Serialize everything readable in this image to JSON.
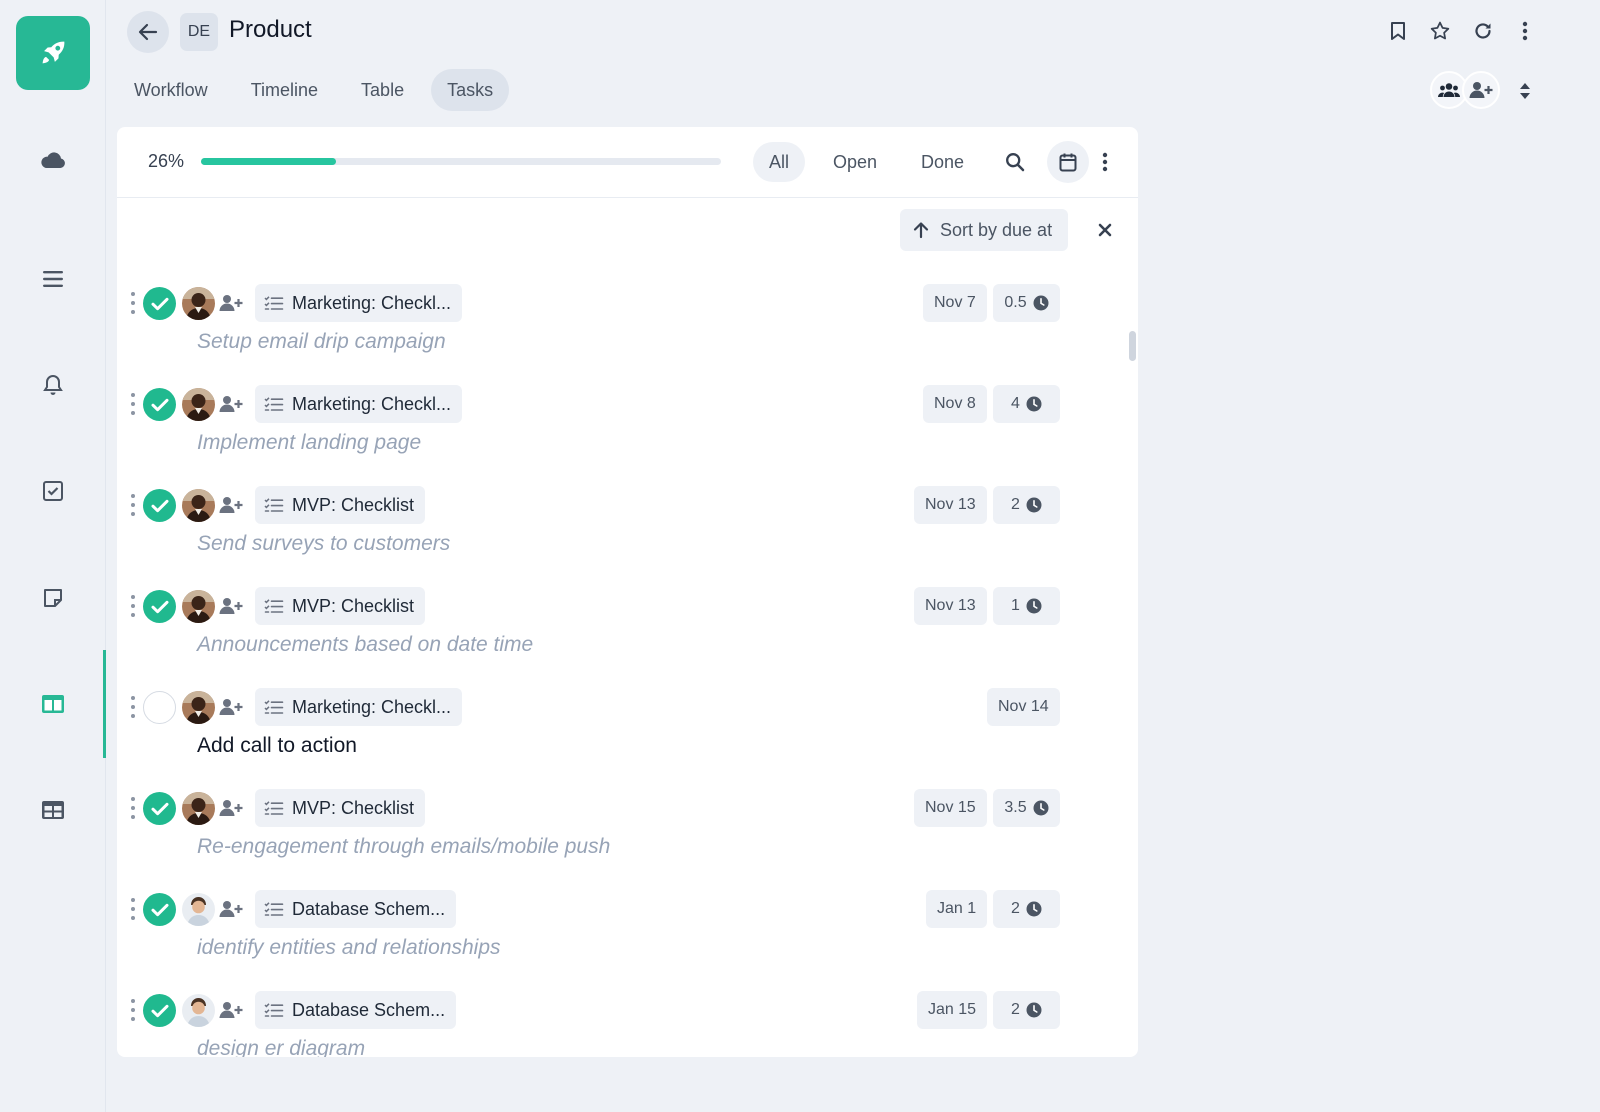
{
  "header": {
    "workspace_badge": "DE",
    "title": "Product",
    "tabs": [
      {
        "label": "Workflow",
        "active": false
      },
      {
        "label": "Timeline",
        "active": false
      },
      {
        "label": "Table",
        "active": false
      },
      {
        "label": "Tasks",
        "active": true
      }
    ]
  },
  "toolbar": {
    "progress_label": "26%",
    "progress_value": 0.26,
    "filters": {
      "all": "All",
      "open": "Open",
      "done": "Done"
    },
    "active_filter": "All"
  },
  "sort": {
    "label": "Sort by due at"
  },
  "colors": {
    "accent": "#27b895",
    "check": "#20b98f",
    "progress": "#27c59f"
  },
  "sidebar": {
    "items": [
      "cloud-icon",
      "list-icon",
      "bell-icon",
      "checkbox-icon",
      "note-icon",
      "board-icon",
      "table-icon"
    ],
    "active": "board-icon"
  },
  "tasks": [
    {
      "list": "Marketing: Checkl...",
      "date": "Nov 7",
      "hours": "0.5",
      "title": "Setup email drip campaign",
      "done": true,
      "avatar": "dark"
    },
    {
      "list": "Marketing: Checkl...",
      "date": "Nov 8",
      "hours": "4",
      "title": "Implement landing page",
      "done": true,
      "avatar": "dark"
    },
    {
      "list": "MVP: Checklist",
      "date": "Nov 13",
      "hours": "2",
      "title": "Send surveys to customers",
      "done": true,
      "avatar": "dark"
    },
    {
      "list": "MVP: Checklist",
      "date": "Nov 13",
      "hours": "1",
      "title": "Announcements based on date time",
      "done": true,
      "avatar": "dark"
    },
    {
      "list": "Marketing: Checkl...",
      "date": "Nov 14",
      "hours": null,
      "title": "Add call to action",
      "done": false,
      "avatar": "dark"
    },
    {
      "list": "MVP: Checklist",
      "date": "Nov 15",
      "hours": "3.5",
      "title": "Re-engagement through emails/mobile push",
      "done": true,
      "avatar": "dark"
    },
    {
      "list": "Database Schem...",
      "date": "Jan 1",
      "hours": "2",
      "title": "identify entities and relationships",
      "done": true,
      "avatar": "light"
    },
    {
      "list": "Database Schem...",
      "date": "Jan 15",
      "hours": "2",
      "title": "design er diagram",
      "done": true,
      "avatar": "light"
    }
  ]
}
